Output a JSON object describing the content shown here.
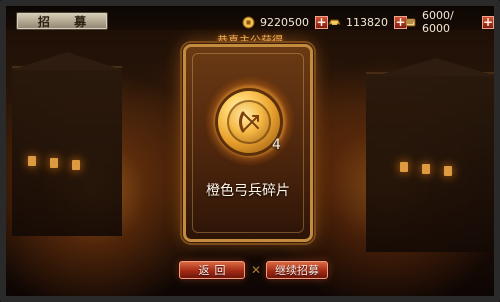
{
  "header": {
    "title": "招 募",
    "resources": [
      {
        "name": "gold",
        "icon": "coin-icon",
        "value": "9220500"
      },
      {
        "name": "ingot",
        "icon": "ingot-icon",
        "value": "113820"
      },
      {
        "name": "stamina",
        "icon": "scroll-icon",
        "value": "6000/ 6000"
      }
    ]
  },
  "modal": {
    "congrats_text": "恭喜主公获得",
    "item_count": "4",
    "item_name": "橙色弓兵碎片",
    "buttons": {
      "back": "返回",
      "continue": "继续招募"
    }
  },
  "colors": {
    "accent": "#f0b25b",
    "button_red": "#a42a15",
    "card_border": "#c28b3e"
  }
}
